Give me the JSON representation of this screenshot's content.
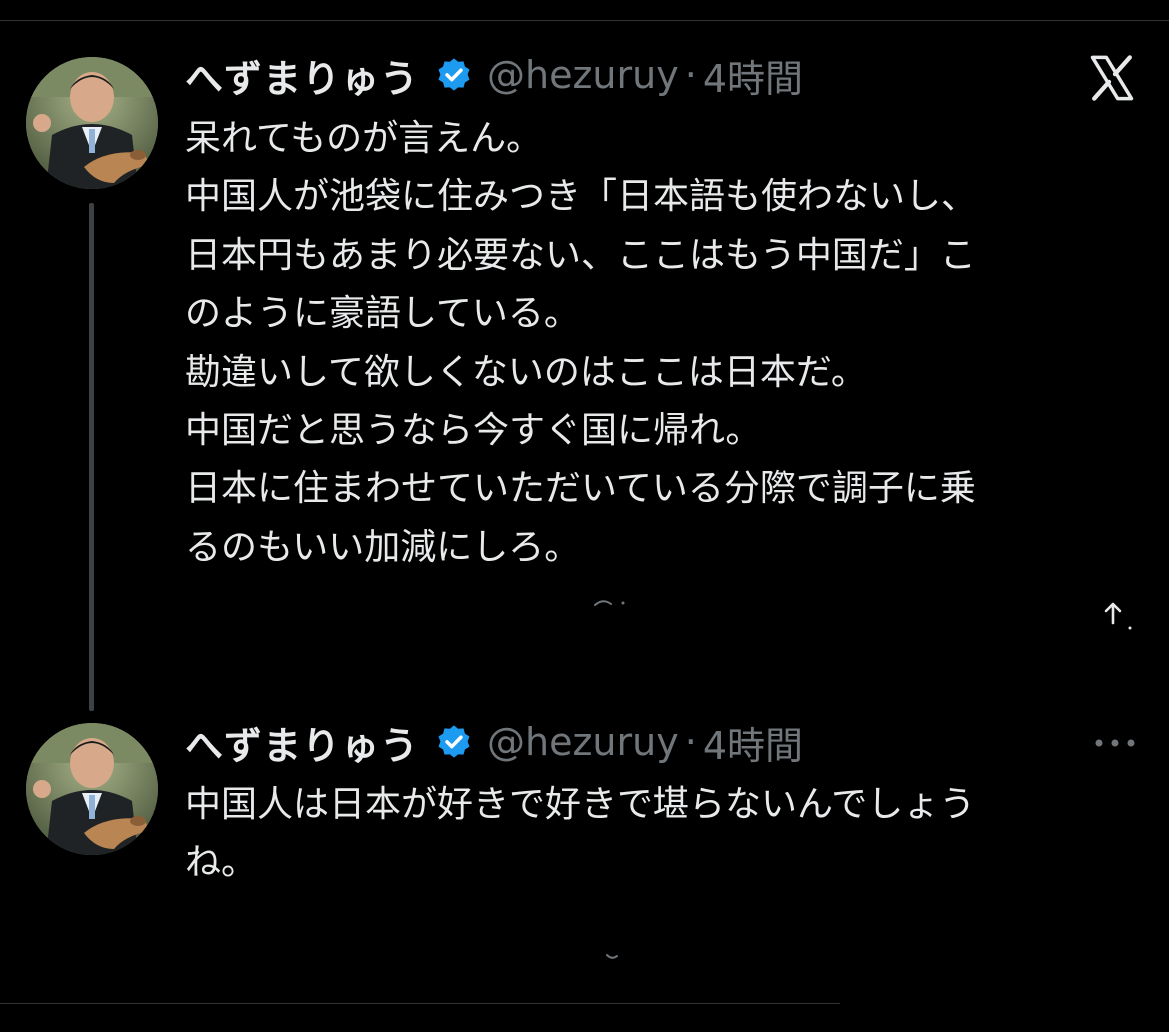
{
  "colors": {
    "background": "#000000",
    "text_primary": "#e7e9ea",
    "text_secondary": "#71767b",
    "verified_badge": "#1d9bf0",
    "thread_line": "#3e4144",
    "divider": "#2f3336"
  },
  "platform_icon": "x-logo-icon",
  "tweets": [
    {
      "display_name": "へずまりゅう",
      "verified": true,
      "handle": "@hezuruy",
      "separator": "·",
      "time": "4時間",
      "lines": [
        "呆れてものが言えん。",
        "中国人が池袋に住みつき「日本語も使わないし、",
        "日本円もあまり必要ない、ここはもう中国だ」こ",
        "のように豪語している。",
        "勘違いして欲しくないのはここは日本だ。",
        "中国だと思うなら今すぐ国に帰れ。",
        "日本に住まわせていただいている分際で調子に乗",
        "るのもいい加減にしろ。"
      ],
      "icons": [
        "avatar",
        "verified-badge-icon",
        "x-logo-icon",
        "share-icon"
      ]
    },
    {
      "display_name": "へずまりゅう",
      "verified": true,
      "handle": "@hezuruy",
      "separator": "·",
      "time": "4時間",
      "lines": [
        "中国人は日本が好きで好きで堪らないんでしょう",
        "ね。"
      ],
      "icons": [
        "avatar",
        "verified-badge-icon",
        "more-options-icon"
      ]
    }
  ]
}
